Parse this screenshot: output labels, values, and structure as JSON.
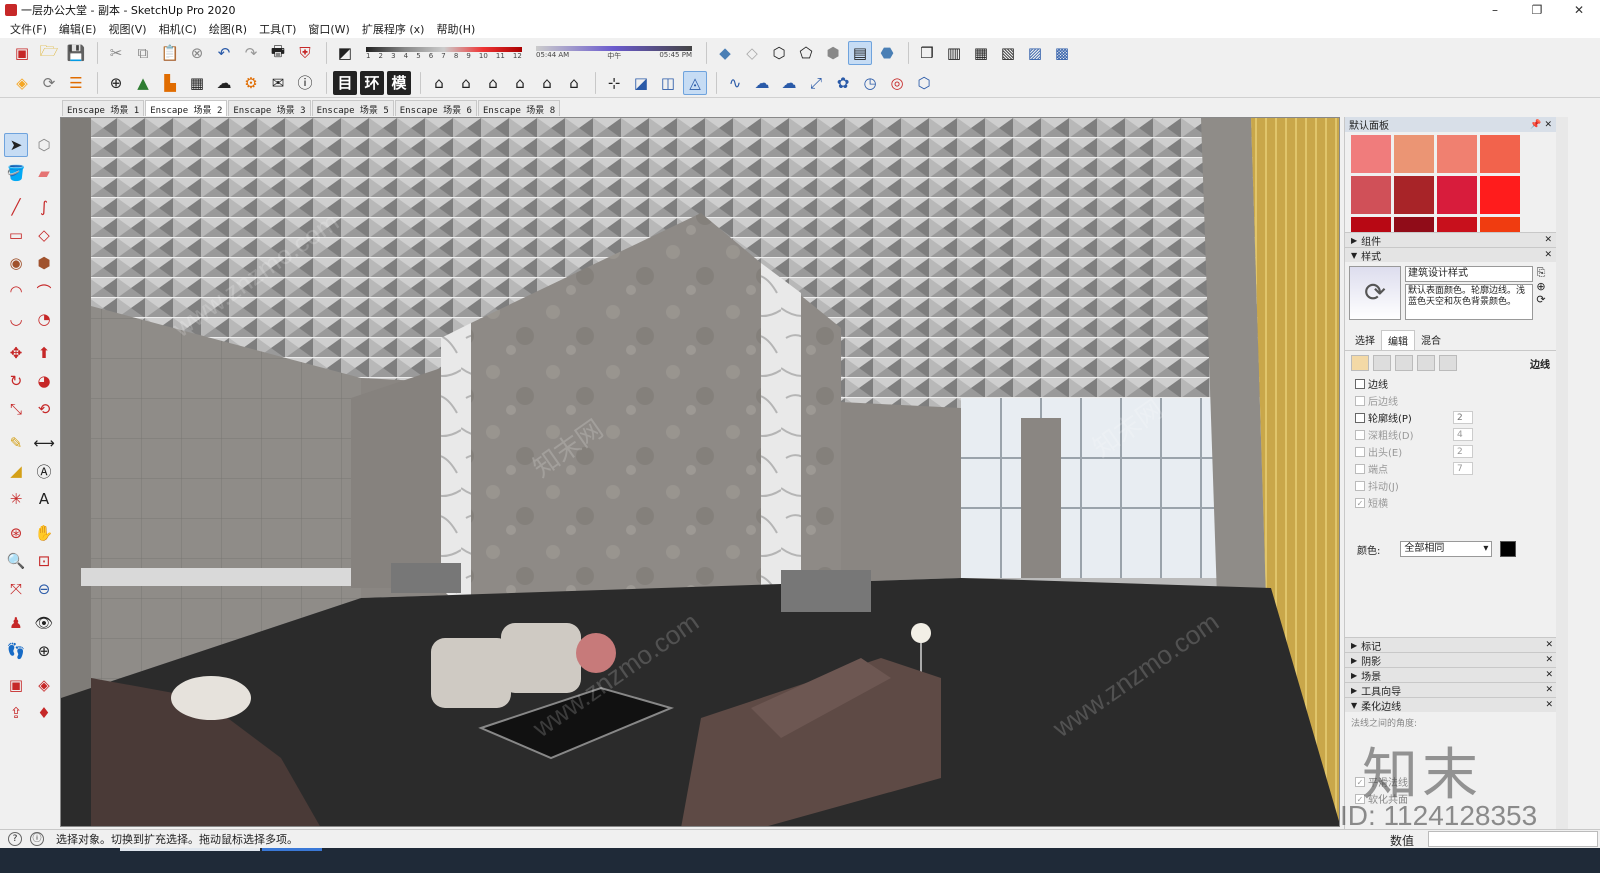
{
  "window": {
    "title": "一层办公大堂 - 副本 - SketchUp Pro 2020",
    "minimize": "–",
    "maximize": "❐",
    "close": "✕"
  },
  "menu": [
    {
      "label": "文件(F)"
    },
    {
      "label": "编辑(E)"
    },
    {
      "label": "视图(V)"
    },
    {
      "label": "相机(C)"
    },
    {
      "label": "绘图(R)"
    },
    {
      "label": "工具(T)"
    },
    {
      "label": "窗口(W)"
    },
    {
      "label": "扩展程序 (x)"
    },
    {
      "label": "帮助(H)"
    }
  ],
  "toolbar": {
    "shadow_months": [
      "1",
      "2",
      "3",
      "4",
      "5",
      "6",
      "7",
      "8",
      "9",
      "10",
      "11",
      "12"
    ],
    "time_start": "05:44 AM",
    "time_mid": "中午",
    "time_end": "05:45 PM",
    "text_buttons": [
      "目",
      "环",
      "模"
    ]
  },
  "scene_tabs": [
    {
      "label": "Enscape 场景 1",
      "active": false
    },
    {
      "label": "Enscape 场景 2",
      "active": true
    },
    {
      "label": "Enscape 场景 3",
      "active": false
    },
    {
      "label": "Enscape 场景 5",
      "active": false
    },
    {
      "label": "Enscape 场景 6",
      "active": false
    },
    {
      "label": "Enscape 场景 8",
      "active": false
    }
  ],
  "tray": {
    "title": "默认面板",
    "palette_colors": [
      "#f07c7c",
      "#eb9574",
      "#f08070",
      "#f2634c",
      "#d05058",
      "#a82428",
      "#d81c3c",
      "#ff1c1c",
      "#b80814",
      "#900c18",
      "#c8101c",
      "#f03c10"
    ],
    "panels_top": [
      {
        "label": "组件",
        "open": false
      },
      {
        "label": "样式",
        "open": true
      }
    ],
    "style": {
      "name": "建筑设计样式",
      "description": "默认表面颜色。轮廓边线。浅蓝色天空和灰色背景颜色。",
      "tabs": [
        "选择",
        "编辑",
        "混合"
      ],
      "active_tab": "编辑",
      "edge_label": "边线",
      "edge_settings": [
        {
          "label": "边线",
          "checked": false,
          "enabled": true,
          "value": ""
        },
        {
          "label": "后边线",
          "checked": false,
          "enabled": false,
          "value": ""
        },
        {
          "label": "轮廓线(P)",
          "checked": false,
          "enabled": true,
          "value": "2"
        },
        {
          "label": "深粗线(D)",
          "checked": false,
          "enabled": false,
          "value": "4"
        },
        {
          "label": "出头(E)",
          "checked": false,
          "enabled": false,
          "value": "2"
        },
        {
          "label": "端点",
          "checked": false,
          "enabled": false,
          "value": "7"
        },
        {
          "label": "抖动(J)",
          "checked": false,
          "enabled": false,
          "value": ""
        },
        {
          "label": "短横",
          "checked": true,
          "enabled": false,
          "value": ""
        }
      ],
      "color_label": "颜色:",
      "color_value": "全部相同"
    },
    "panels_bottom": [
      {
        "label": "标记",
        "open": false
      },
      {
        "label": "阴影",
        "open": false
      },
      {
        "label": "场景",
        "open": false
      },
      {
        "label": "工具向导",
        "open": false
      },
      {
        "label": "柔化边线",
        "open": true
      }
    ],
    "soften": {
      "angle_label": "法线之间的角度:",
      "smooth_normals": "平滑法线",
      "soften_coplanar": "软化共面"
    }
  },
  "status": {
    "text": "选择对象。切换到扩充选择。拖动鼠标选择多项。",
    "measure_label": "数值",
    "measure_value": ""
  },
  "watermark": {
    "logo": "知末",
    "id": "ID: 1124128353",
    "url_text": "www.znzmo.com",
    "site_cn": "知末网"
  },
  "colors": {
    "selection_blue": "#c6dcf4",
    "palette_title_bg": "#d8dfe8"
  }
}
